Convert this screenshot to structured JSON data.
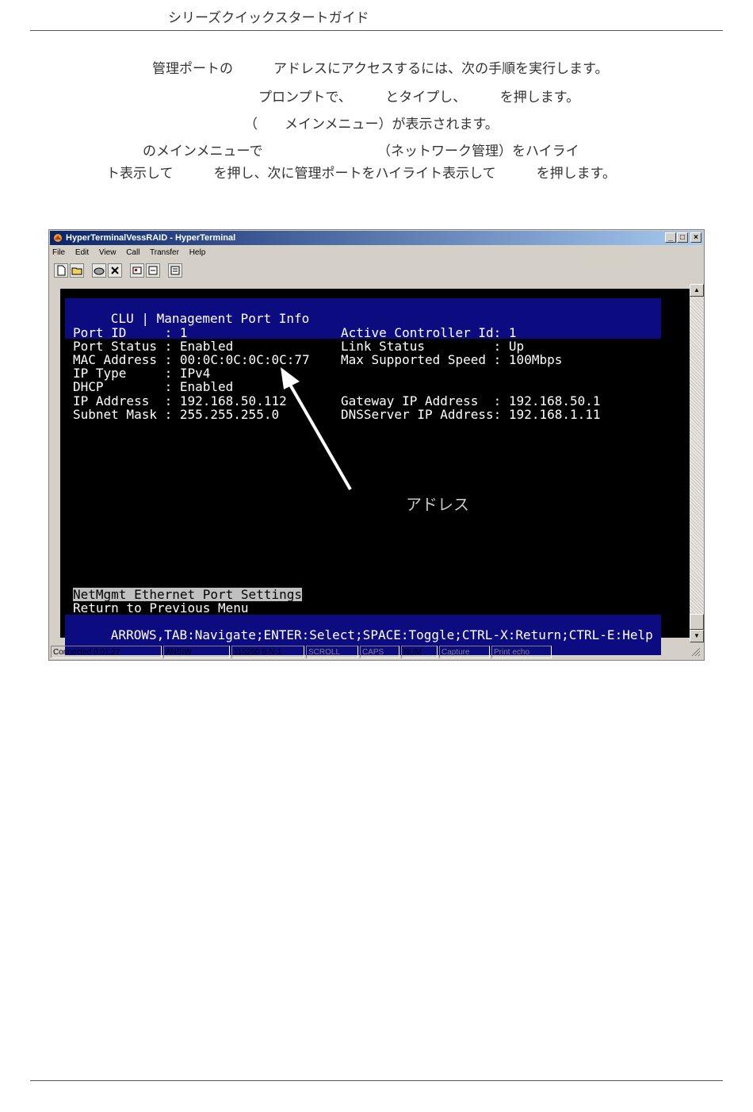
{
  "header": {
    "title": "シリーズクイックスタートガイド"
  },
  "instructions": {
    "line1": "管理ポートの　　　アドレスにアクセスするには、次の手順を実行します。",
    "line2": "プロンプトで、　　　とタイプし、　　　を押します。",
    "line3": "（　　メインメニュー）が表示されます。",
    "line4": "のメインメニューで　　　　　　　　　（ネットワーク管理）をハイライ",
    "line5": "ト表示して　　　を押し、次に管理ポートをハイライト表示して　　　を押します。"
  },
  "window": {
    "title": "HyperTerminalVessRAID - HyperTerminal",
    "menus": [
      "File",
      "Edit",
      "View",
      "Call",
      "Transfer",
      "Help"
    ],
    "buttons": {
      "minimize": "_",
      "maximize": "□",
      "close": "×"
    }
  },
  "terminal": {
    "header": "CLU | Management Port Info",
    "left_rows": [
      "Port ID     : 1",
      "Port Status : Enabled",
      "MAC Address : 00:0C:0C:0C:0C:77",
      "IP Type     : IPv4",
      "DHCP        : Enabled",
      "IP Address  : 192.168.50.112",
      "Subnet Mask : 255.255.255.0"
    ],
    "right_rows": [
      "Active Controller Id: 1",
      "Link Status         : Up",
      "Max Supported Speed : 100Mbps",
      "",
      "",
      "Gateway IP Address  : 192.168.50.1",
      "DNSServer IP Address: 192.168.1.11"
    ],
    "menu_selected": "NetMgmt Ethernet Port Settings",
    "menu_return": "Return to Previous Menu",
    "help_bar": "ARROWS,TAB:Navigate;ENTER:Select;SPACE:Toggle;CTRL-X:Return;CTRL-E:Help"
  },
  "annotation": {
    "label": "アドレス"
  },
  "statusbar": {
    "connected": "Connected 0:01:27",
    "emulation": "ANSIW",
    "port_settings": "115200 8-N-1",
    "scroll": "SCROLL",
    "caps": "CAPS",
    "num": "NUM",
    "capture": "Capture",
    "print_echo": "Print echo"
  }
}
